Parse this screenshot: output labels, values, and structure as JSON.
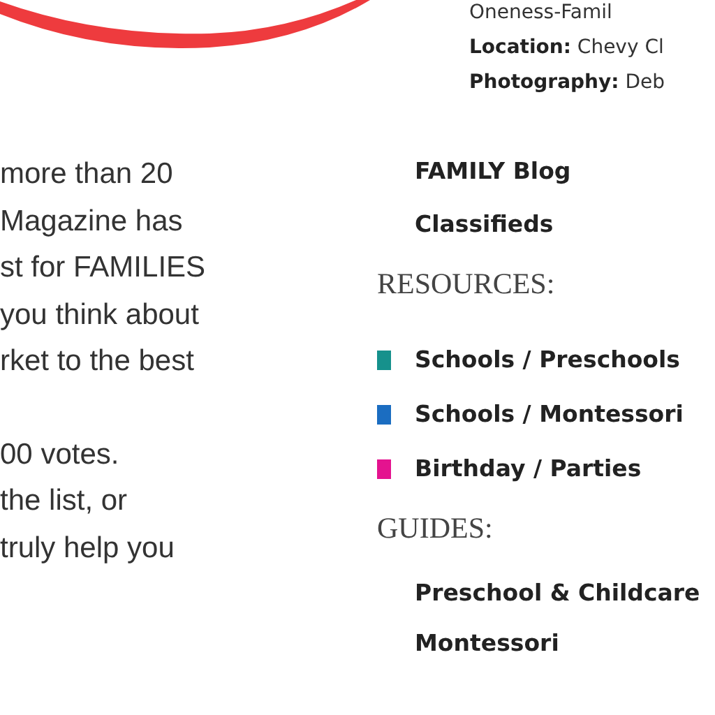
{
  "credits": [
    {
      "value": "Oneness-Famil"
    },
    {
      "label": "Location:",
      "value": "Chevy Cl"
    },
    {
      "label": "Photography:",
      "value": "Deb"
    }
  ],
  "article": {
    "paragraphs": [
      [
        "more than 20",
        "Magazine has",
        "st for FAMILIES",
        "you think about",
        "rket to the best"
      ],
      [
        "00 votes.",
        "the list, or",
        "truly help you"
      ]
    ]
  },
  "sidebar": {
    "links": [
      "FAMILY Blog",
      "Classifieds"
    ],
    "sections": [
      {
        "heading": "RESOURCES:",
        "items": [
          {
            "label": "Schools / Preschools",
            "color": "#16918c"
          },
          {
            "label": "Schools / Montessori",
            "color": "#1b6dc1"
          },
          {
            "label": "Birthday / Parties",
            "color": "#e4138f"
          }
        ]
      },
      {
        "heading": "GUIDES:",
        "items": [
          {
            "label": "Preschool & Childcare"
          },
          {
            "label": "Montessori"
          }
        ]
      }
    ]
  }
}
